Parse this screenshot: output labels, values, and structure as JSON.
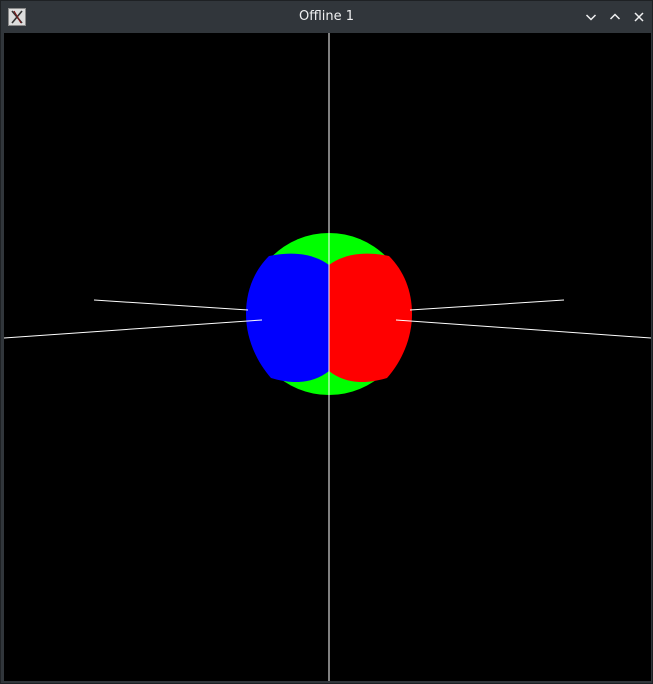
{
  "window": {
    "title": "Offline 1",
    "app_icon": "x-app-icon",
    "controls": {
      "minimize_icon": "chevron-down-icon",
      "maximize_icon": "chevron-up-icon",
      "close_icon": "close-icon"
    }
  },
  "scene": {
    "background_color": "#000000",
    "axis_color": "#ffffff",
    "sphere_colors": {
      "top_bottom": "#00ff00",
      "left": "#0000ff",
      "right": "#ff0000"
    }
  }
}
